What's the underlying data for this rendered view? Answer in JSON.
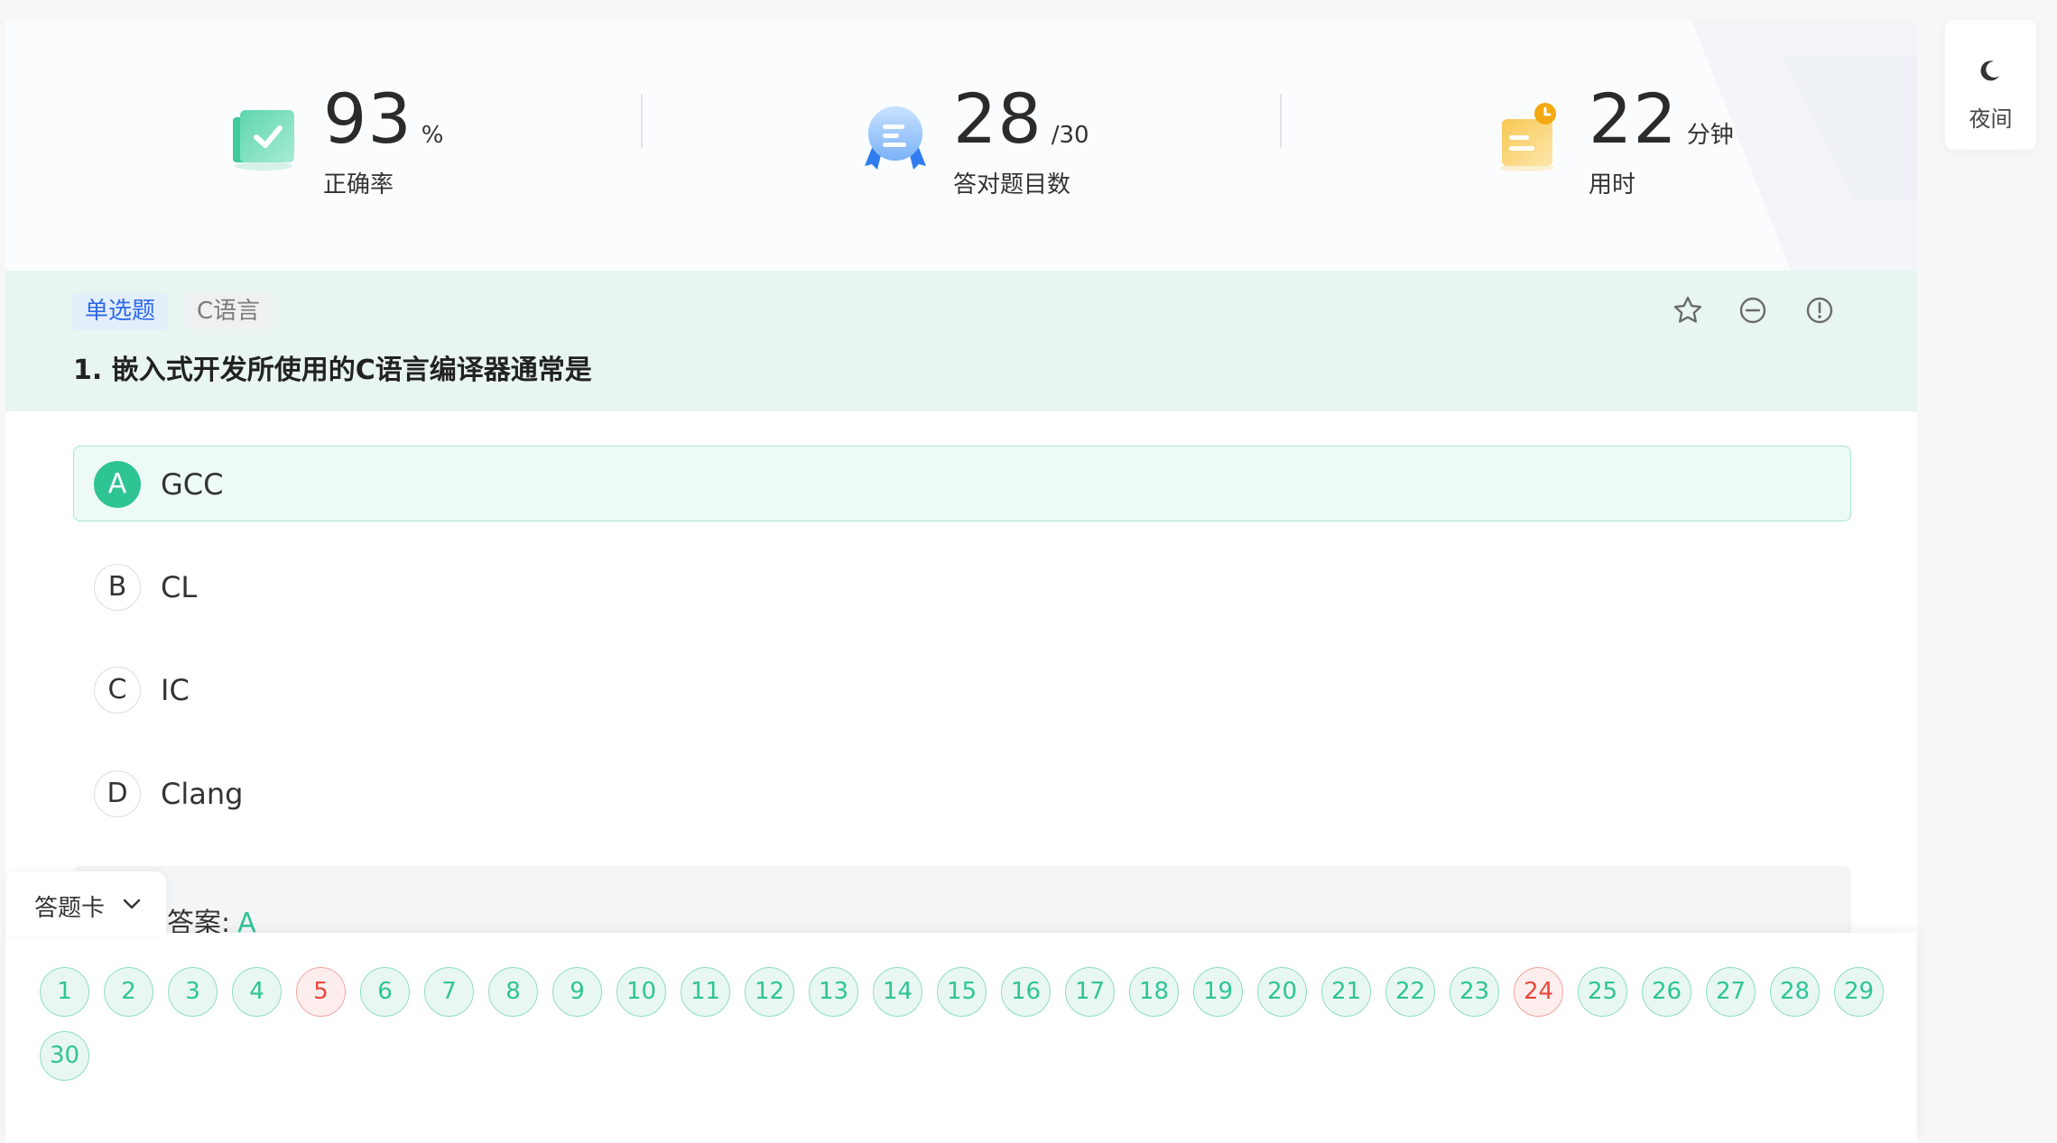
{
  "stats": {
    "accuracy": {
      "value": "93",
      "unit": "%",
      "label": "正确率"
    },
    "correct": {
      "value": "28",
      "unit": "/30",
      "label": "答对题目数"
    },
    "time": {
      "value": "22",
      "unit": "分钟",
      "label": "用时"
    }
  },
  "question": {
    "type_tag": "单选题",
    "subject_tag": "C语言",
    "title": "1. 嵌入式开发所使用的C语言编译器通常是",
    "actions": [
      "star-icon",
      "minus-circle-icon",
      "alert-circle-icon"
    ],
    "options": [
      {
        "letter": "A",
        "text": "GCC",
        "selected": true
      },
      {
        "letter": "B",
        "text": "CL",
        "selected": false
      },
      {
        "letter": "C",
        "text": "IC",
        "selected": false
      },
      {
        "letter": "D",
        "text": "Clang",
        "selected": false
      }
    ],
    "answer_label": "答案:",
    "answer_value": "A"
  },
  "answer_card": {
    "label": "答题卡",
    "numbers": [
      "1",
      "2",
      "3",
      "4",
      "5",
      "6",
      "7",
      "8",
      "9",
      "10",
      "11",
      "12",
      "13",
      "14",
      "15",
      "16",
      "17",
      "18",
      "19",
      "20",
      "21",
      "22",
      "23",
      "24",
      "25",
      "26",
      "27",
      "28",
      "29",
      "30"
    ],
    "wrong": [
      "5",
      "24"
    ]
  },
  "night_mode": {
    "label": "夜间"
  },
  "colors": {
    "accent": "#2fc494",
    "wrong": "#e9483c",
    "tag_blue": "#2d6ae8",
    "question_bg": "#e8f5f1"
  }
}
